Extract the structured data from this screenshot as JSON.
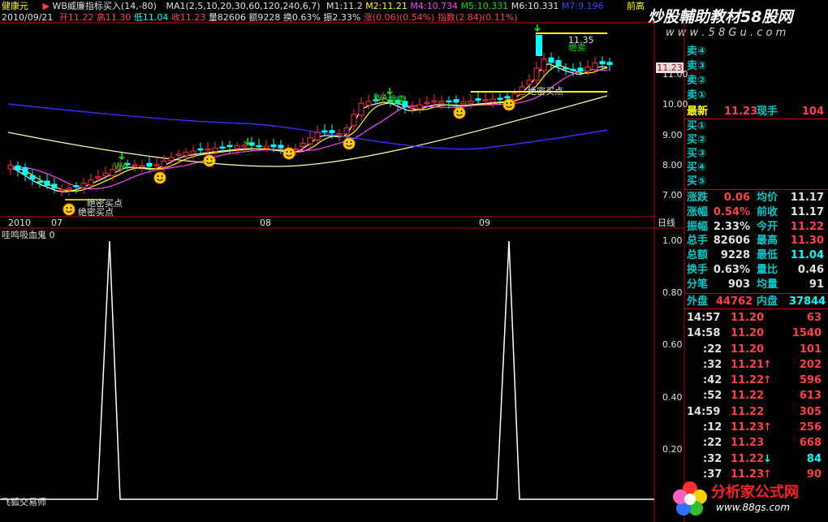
{
  "header": {
    "stock_name": "健康元",
    "indicator_title": "WB威廉指标买入",
    "indicator_params": "(14,-80)",
    "ma_label": "MA1(2,5,10,20,30,60,120,240,6,7)",
    "m1": "M1:11.2",
    "m2": "M2:11.21",
    "m4": "M4:10.734",
    "m5": "M5:10.331",
    "m6": "M6:10.331",
    "m7": "M7:9.196",
    "prev_label": "前高",
    "date": "2010/09/21",
    "open": "开11.22",
    "high": "高11.30",
    "low": "低11.04",
    "close": "收11.23",
    "volume": "量82606",
    "amount": "额9228",
    "turnover": "换0.63%",
    "amplitude": "振2.33%",
    "rise": "涨(0.06)(0.54%)",
    "index": "指数(2.84)(0.11%)"
  },
  "watermark": {
    "top": "炒股輔助教材58股网",
    "top_url": "w w w . 5 8 G u . c o m",
    "bottom": "分析家公式网",
    "bottom_url": "www.88gs.com"
  },
  "kline": {
    "price_ticks": [
      "11.00",
      "10.00",
      "9.00",
      "8.00",
      "7.00"
    ],
    "months": [
      "2010",
      "07",
      "08",
      "09"
    ],
    "period": "日线",
    "current_tag": "11.23",
    "annotations": [
      "绝密买点",
      "绝密买点",
      "绝卖",
      "绝卖",
      "WA"
    ],
    "high_marker": "11.35"
  },
  "sub_chart": {
    "title": "哇鸣吸血鬼 0",
    "ticks": [
      "1.00",
      "0.80",
      "0.60",
      "0.40",
      "0.20"
    ],
    "bottom_label": "飞狐交易师"
  },
  "quote": {
    "sell": [
      "卖⑤",
      "卖④",
      "卖③",
      "卖②",
      "卖①"
    ],
    "buy": [
      "买①",
      "买②",
      "买③",
      "买④",
      "买⑤"
    ],
    "latest_label": "最新",
    "latest": "11.23",
    "hand_label": "现手",
    "hand": "104",
    "stats": [
      {
        "l1": "涨跌",
        "v1": "0.06",
        "l2": "均价",
        "v2": "11.17"
      },
      {
        "l1": "涨幅",
        "v1": "0.54%",
        "l2": "前收",
        "v2": "11.17"
      },
      {
        "l1": "振幅",
        "v1": "2.33%",
        "l2": "今开",
        "v2": "11.22"
      },
      {
        "l1": "总手",
        "v1": "82606",
        "l2": "最高",
        "v2": "11.30"
      },
      {
        "l1": "总额",
        "v1": "9228",
        "l2": "最低",
        "v2": "11.04"
      },
      {
        "l1": "换手",
        "v1": "0.63%",
        "l2": "量比",
        "v2": "0.46"
      },
      {
        "l1": "分笔",
        "v1": "903",
        "l2": "均量",
        "v2": "91"
      }
    ],
    "outer_label": "外盘",
    "outer": "44762",
    "inner_label": "内盘",
    "inner": "37844"
  },
  "ticks": [
    {
      "t": "14:57",
      "p": "11.20",
      "v": "63",
      "a": ""
    },
    {
      "t": "14:58",
      "p": "11.20",
      "v": "1540",
      "a": ""
    },
    {
      "t": ":22",
      "p": "11.20",
      "v": "101",
      "a": ""
    },
    {
      "t": ":32",
      "p": "11.21",
      "v": "202",
      "a": "up"
    },
    {
      "t": ":42",
      "p": "11.22",
      "v": "596",
      "a": "up"
    },
    {
      "t": ":52",
      "p": "11.22",
      "v": "613",
      "a": ""
    },
    {
      "t": "14:59",
      "p": "11.22",
      "v": "305",
      "a": ""
    },
    {
      "t": ":12",
      "p": "11.23",
      "v": "256",
      "a": "up"
    },
    {
      "t": ":22",
      "p": "11.23",
      "v": "668",
      "a": ""
    },
    {
      "t": ":32",
      "p": "11.22",
      "v": "84",
      "a": "down"
    },
    {
      "t": ":37",
      "p": "11.23",
      "v": "90",
      "a": "up"
    }
  ]
}
